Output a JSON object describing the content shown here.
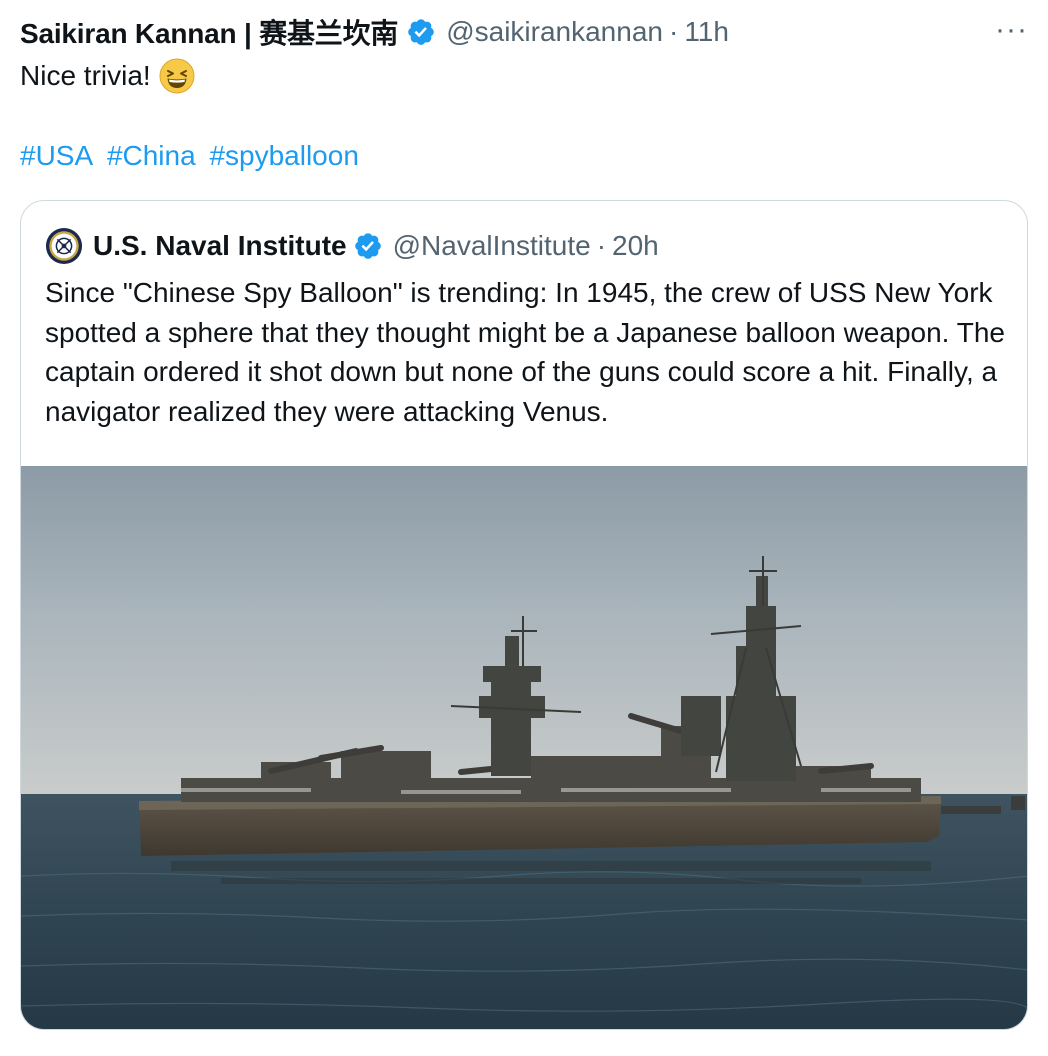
{
  "tweet": {
    "author_name": "Saikiran Kannan | 赛基兰坎南",
    "author_handle": "@saikirankannan",
    "separator": "·",
    "time": "11h",
    "more_label": "···",
    "text": "Nice trivia!",
    "emoji": "grinning-squinting-face",
    "hashtags": [
      "#USA",
      "#China",
      "#spyballoon"
    ]
  },
  "quoted": {
    "author_name": "U.S. Naval Institute",
    "author_handle": "@NavalInstitute",
    "separator": "·",
    "time": "20h",
    "text": "Since \"Chinese Spy Balloon\" is trending: In 1945, the crew of USS New York spotted a sphere that they thought might be a Japanese balloon weapon. The captain ordered it shot down but none of the guns could score a hit. Finally, a navigator realized they were attacking Venus.",
    "media_subject": "battleship-photo"
  },
  "colors": {
    "text": "#0f1419",
    "secondary": "#536471",
    "link": "#1d9bf0",
    "verified": "#1d9bf0",
    "border": "#cfd9de"
  }
}
